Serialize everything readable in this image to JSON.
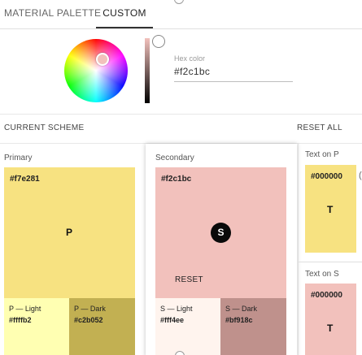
{
  "tabs": {
    "material_palette": "MATERIAL PALETTE",
    "custom": "CUSTOM"
  },
  "picker": {
    "hex_label": "Hex color",
    "hex_value": "#f2c1bc"
  },
  "scheme": {
    "title": "CURRENT SCHEME",
    "reset_all": "RESET ALL"
  },
  "primary": {
    "title": "Primary",
    "main_hex": "#f7e281",
    "letter": "P",
    "light_label": "P — Light",
    "light_hex": "#ffffb2",
    "dark_label": "P — Dark",
    "dark_hex": "#c2b052"
  },
  "secondary": {
    "title": "Secondary",
    "main_hex": "#f2c1bc",
    "letter": "S",
    "reset": "RESET",
    "light_label": "S — Light",
    "light_hex": "#fff4ee",
    "dark_label": "S — Dark",
    "dark_hex": "#bf918c"
  },
  "text_on_p": {
    "title": "Text on P",
    "hex": "#000000",
    "letter": "T"
  },
  "text_on_s": {
    "title": "Text on S",
    "hex": "#000000",
    "letter": "T"
  },
  "colors": {
    "primary": "#f7e281",
    "primary_light": "#ffffb2",
    "primary_dark": "#c2b052",
    "secondary": "#f2c1bc",
    "secondary_light": "#fff4ee",
    "secondary_dark": "#bf918c"
  }
}
